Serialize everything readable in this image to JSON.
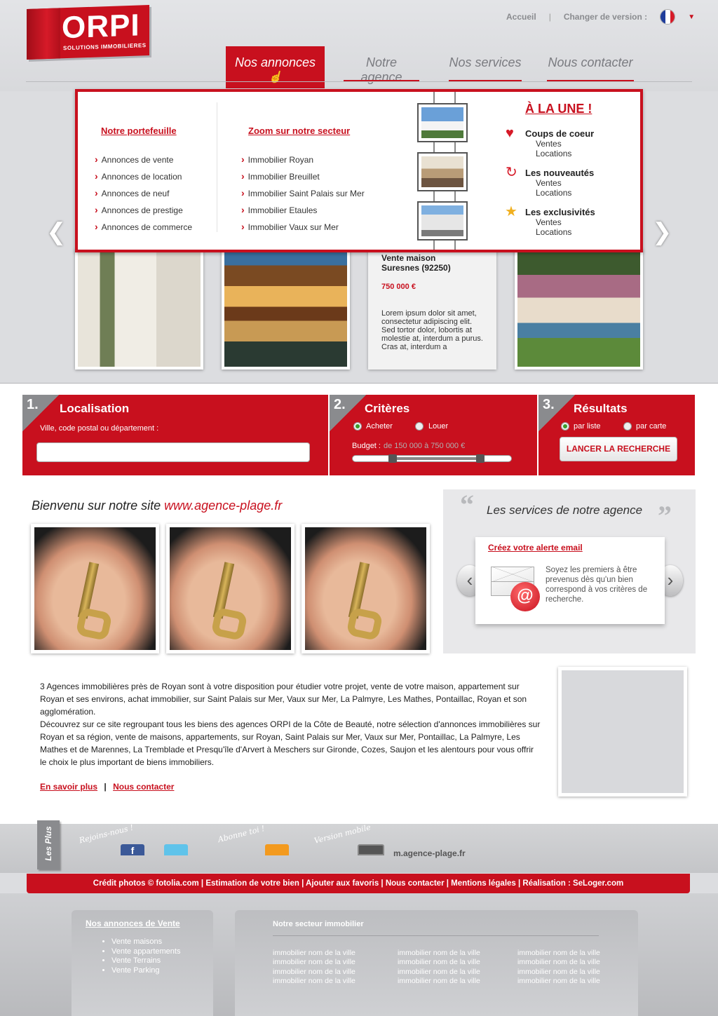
{
  "header": {
    "logo_text": "ORPI",
    "logo_sub": "SOLUTIONS IMMOBILIERES",
    "top_links": {
      "home": "Accueil",
      "change_version": "Changer de version :"
    },
    "nav": [
      {
        "label": "Nos annonces"
      },
      {
        "label": "Notre agence"
      },
      {
        "label": "Nos services"
      },
      {
        "label": "Nous contacter"
      }
    ]
  },
  "dropdown": {
    "portfolio_title": "Notre portefeuille",
    "portfolio_items": [
      "Annonces de vente",
      "Annonces de location",
      "Annonces de neuf",
      "Annonces de prestige",
      "Annonces de commerce"
    ],
    "sector_title": "Zoom sur notre secteur",
    "sector_items": [
      "Immobilier Royan",
      "Immobilier Breuillet",
      "Immobilier Saint Palais sur Mer",
      "Immobilier Etaules",
      "Immobilier Vaux sur Mer"
    ],
    "une_title": "À LA UNE !",
    "une_groups": [
      {
        "title": "Coups de coeur",
        "sub1": "Ventes",
        "sub2": "Locations"
      },
      {
        "title": "Les nouveautés",
        "sub1": "Ventes",
        "sub2": "Locations"
      },
      {
        "title": "Les exclusivités",
        "sub1": "Ventes",
        "sub2": "Locations"
      }
    ]
  },
  "carousel": {
    "featured": {
      "title_line1": "Vente maison",
      "title_line2": "Suresnes (92250)",
      "price": "750 000 €",
      "description": "Lorem ipsum dolor sit amet, consectetur adipiscing elit. Sed tortor dolor, lobortis at molestie at, interdum a purus. Cras at, interdum a"
    }
  },
  "search": {
    "step1": {
      "num": "1.",
      "title": "Localisation",
      "label": "Ville, code postal ou département :",
      "value": ""
    },
    "step2": {
      "num": "2.",
      "title": "Critères",
      "opt_buy": "Acheter",
      "opt_rent": "Louer",
      "budget_label": "Budget :",
      "budget_range": "de 150 000 à 750 000 €",
      "range_start": 0.25,
      "range_end": 0.8
    },
    "step3": {
      "num": "3.",
      "title": "Résultats",
      "opt_list": "par liste",
      "opt_map": "par carte",
      "button": "LANCER LA RECHERCHE"
    }
  },
  "welcome": {
    "title_prefix": "Bienvenu sur notre site",
    "title_url": "www.agence-plage.fr"
  },
  "services": {
    "title": "Les services de notre agence",
    "card_title": "Créez votre alerte email",
    "card_text": "Soyez les premiers à être prevenus dès qu'un bien correspond à vos critères de recherche."
  },
  "intro": {
    "para1": "3 Agences immobilières près de Royan sont à votre disposition pour étudier votre projet, vente de votre maison, appartement sur Royan et ses environs, achat immobilier, sur Saint Palais sur Mer, Vaux sur Mer, La Palmyre, Les Mathes, Pontaillac, Royan et son agglomération.",
    "para2": "Découvrez sur ce site regroupant tous les biens des agences ORPI de la Côte de Beauté, notre sélection d'annonces immobilières sur Royan et sa région, vente de maisons, appartements, sur Royan, Saint Palais sur Mer, Vaux sur Mer, Pontaillac, La Palmyre, Les Mathes et de Marennes, La Tremblade et Presqu'île d'Arvert à Meschers sur Gironde, Cozes, Saujon et les alentours pour vous offrir le choix le plus important de biens immobiliers.",
    "link_more": "En savoir plus",
    "link_sep": "|",
    "link_contact": "Nous contacter"
  },
  "social": {
    "tab": "Les Plus",
    "join": "Rejoins-nous !",
    "subscribe": "Abonne toi !",
    "mobile": "Version mobile",
    "mobile_url": "m.agence-plage.fr"
  },
  "footer": {
    "credits": "Crédit photos © fotolia.com | Estimation de votre bien | Ajouter aux favoris | Nous contacter | Mentions légales | Réalisation : SeLoger.com",
    "sale_title": "Nos annonces de Vente",
    "sale_items": [
      "Vente maisons",
      "Vente appartements",
      "Vente Terrains",
      "Vente Parking"
    ],
    "sector_title": "Notre secteur immobilier",
    "sector_col1": [
      "immobilier nom de la ville",
      "immobilier nom de la ville",
      "immobilier nom de la ville",
      "immobilier nom de la ville"
    ],
    "sector_col2": [
      "immobilier nom de la ville",
      "immobilier nom de la ville",
      "immobilier nom de la ville",
      "immobilier nom de la ville"
    ],
    "sector_col3": [
      "immobilier nom de la ville",
      "immobilier nom de la ville",
      "immobilier nom de la ville",
      "immobilier nom de la ville"
    ]
  },
  "colors": {
    "brand": "#c8101e",
    "grey": "#8a8b8e"
  },
  "icons": [
    "heart-icon",
    "refresh-icon",
    "star-icon",
    "email-icon",
    "facebook-icon",
    "twitter-icon",
    "rss-icon",
    "mobile-icon",
    "france-flag-icon"
  ]
}
